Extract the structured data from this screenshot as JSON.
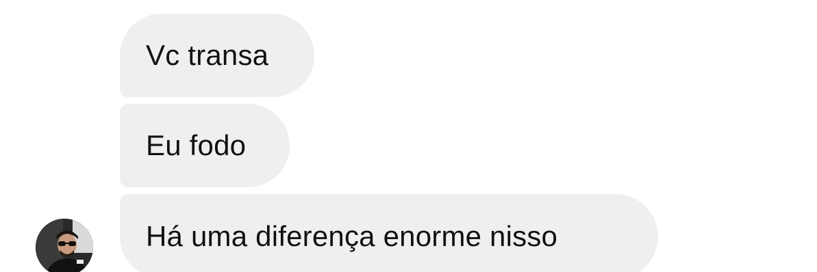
{
  "conversation": {
    "messages": [
      {
        "text": "Vc transa"
      },
      {
        "text": "Eu fodo"
      },
      {
        "text": "Há uma diferença enorme nisso"
      }
    ]
  },
  "avatar": {
    "icon": "user-avatar-photo"
  },
  "colors": {
    "bubble_background": "#efefef",
    "text": "#111111",
    "page_background": "#ffffff"
  }
}
